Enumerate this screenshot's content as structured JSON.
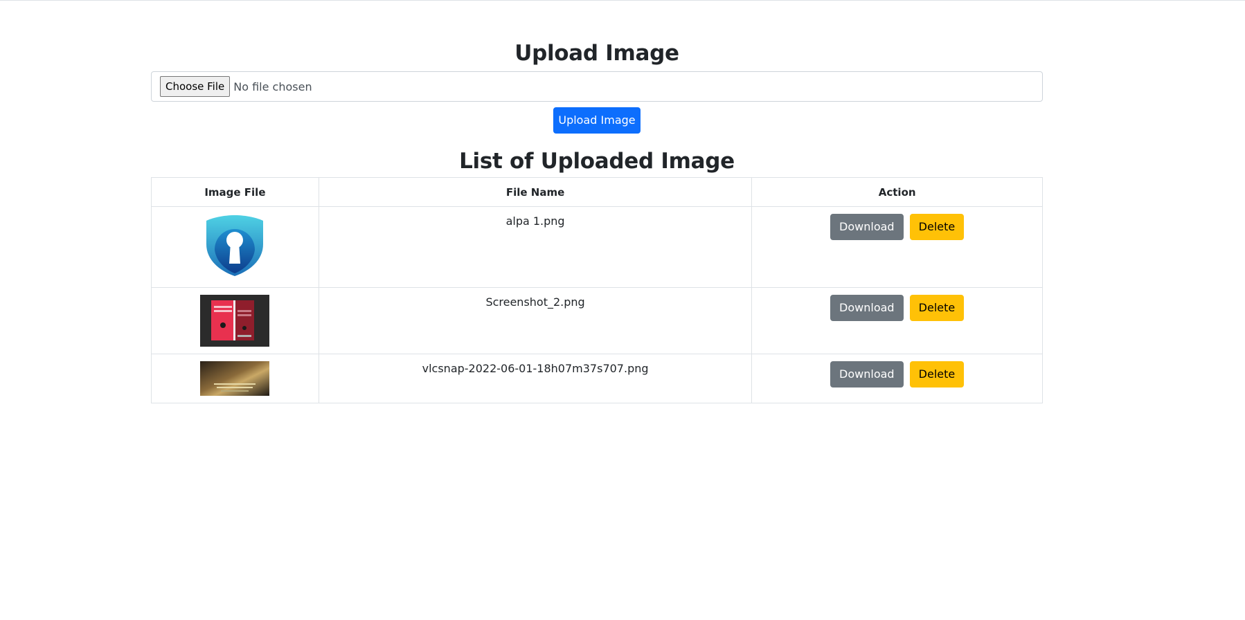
{
  "upload": {
    "title": "Upload Image",
    "choose_label": "Choose File",
    "file_status": "No file chosen",
    "submit_label": "Upload Image"
  },
  "list": {
    "title": "List of Uploaded Image",
    "headers": [
      "Image File",
      "File Name",
      "Action"
    ],
    "rows": [
      {
        "file_name": "alpa 1.png",
        "thumbnail": "shield-keyhole-logo",
        "download_label": "Download",
        "delete_label": "Delete"
      },
      {
        "file_name": "Screenshot_2.png",
        "thumbnail": "red-login-screenshot",
        "download_label": "Download",
        "delete_label": "Delete"
      },
      {
        "file_name": "vlcsnap-2022-06-01-18h07m37s707.png",
        "thumbnail": "dark-video-frame",
        "download_label": "Download",
        "delete_label": "Delete"
      }
    ]
  },
  "colors": {
    "primary": "#0d6efd",
    "secondary": "#6c757d",
    "warning": "#ffc107",
    "border": "#dee2e6"
  }
}
